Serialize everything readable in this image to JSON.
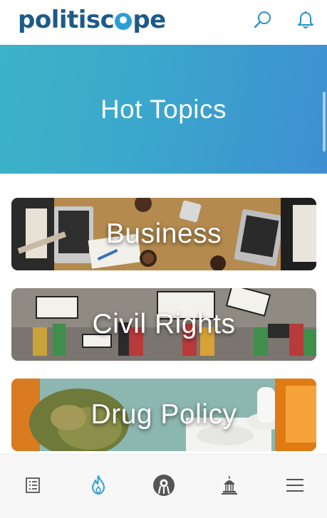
{
  "header": {
    "logo_left": "politisc",
    "logo_right": "pe",
    "icons": [
      "search-icon",
      "bell-icon"
    ]
  },
  "hero": {
    "title": "Hot Topics"
  },
  "topics": [
    {
      "label": "Business"
    },
    {
      "label": "Civil Rights"
    },
    {
      "label": "Drug Policy"
    }
  ],
  "bottom_nav": {
    "items": [
      "list-icon",
      "flame-icon",
      "politiscope-icon",
      "capitol-icon",
      "menu-icon"
    ],
    "active": "flame-icon"
  },
  "colors": {
    "brand_dark": "#1e5a87",
    "brand_accent": "#2a9fd6",
    "hero_start": "#3cb3c8",
    "hero_end": "#3e8fd1",
    "nav_active": "#2a9fd6",
    "nav_inactive": "#555555"
  }
}
